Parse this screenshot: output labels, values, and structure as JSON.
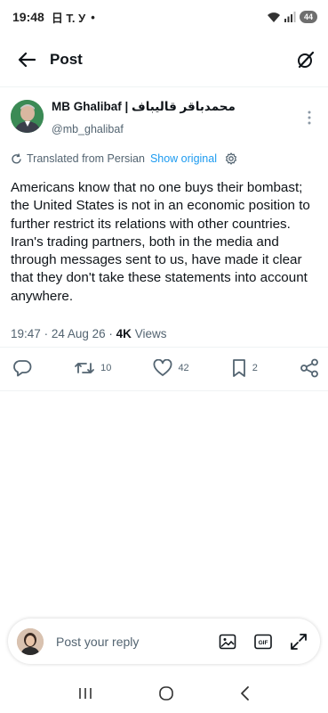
{
  "status_bar": {
    "time": "19:48",
    "notification_glyphs": "日 T. У",
    "dot": "•",
    "battery": "44"
  },
  "header": {
    "title": "Post",
    "back_icon": "arrow-left-icon",
    "grok_icon": "grok-icon"
  },
  "post": {
    "author_name": "MB Ghalibaf | محمدباقر قالیباف",
    "author_handle": "@mb_ghalibaf",
    "translated_label": "Translated from Persian",
    "show_original_label": "Show original",
    "paragraphs": [
      "Americans know that no one buys their bombast; the United States is not in an economic position to further restrict its relations with other countries.",
      "Iran's trading partners, both in the media and through messages sent to us, have made it clear that they don't take these statements into account anywhere."
    ],
    "time": "19:47",
    "date": "24 Aug 26",
    "views_count": "4K",
    "views_label": "Views",
    "separator": "·",
    "reposts": "10",
    "likes": "42",
    "bookmarks": "2"
  },
  "reply": {
    "placeholder": "Post your reply"
  },
  "colors": {
    "accent": "#1d9bf0",
    "text": "#0f1419",
    "secondary": "#536471"
  }
}
